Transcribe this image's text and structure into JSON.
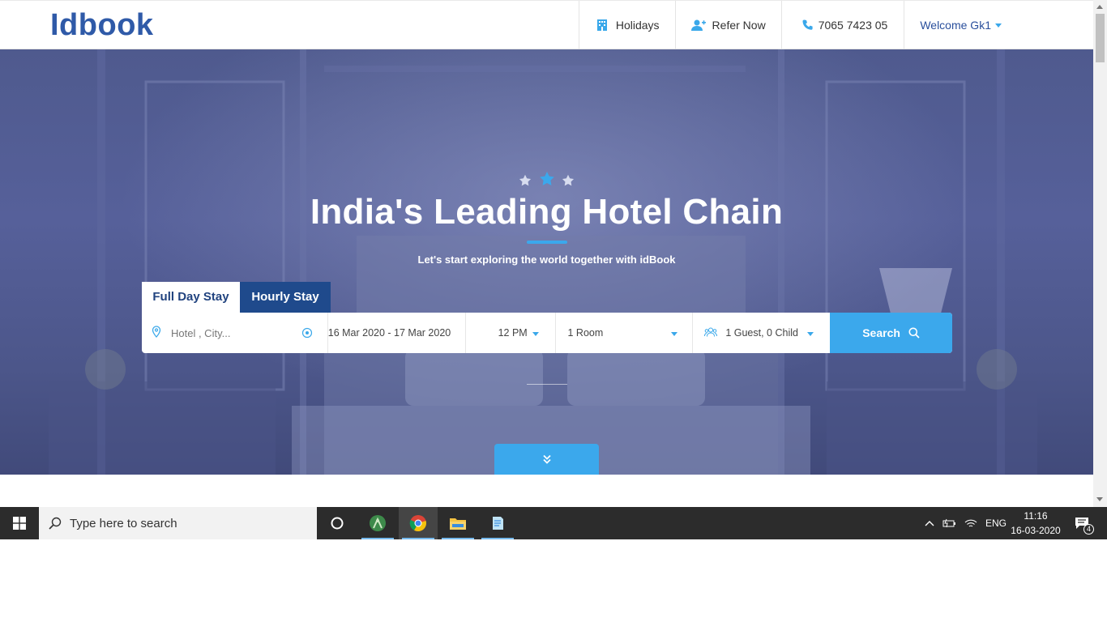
{
  "brand": {
    "logo": "Idbook",
    "logo_color": "#2f5aa8"
  },
  "nav": {
    "holidays": "Holidays",
    "refer": "Refer Now",
    "phone": "7065 7423 05",
    "welcome": "Welcome Gk1"
  },
  "hero": {
    "headline": "India's Leading Hotel Chain",
    "subline": "Let's start exploring the world together with idBook",
    "accent_color": "#3ba8ec"
  },
  "tabs": {
    "full_day": "Full Day Stay",
    "hourly": "Hourly Stay"
  },
  "search": {
    "hotel_placeholder": "Hotel , City...",
    "dates": "16 Mar 2020 - 17 Mar 2020",
    "time": "12 PM",
    "rooms": "1 Room",
    "guests": "1 Guest, 0 Child",
    "button": "Search"
  },
  "taskbar": {
    "search_placeholder": "Type here to search",
    "language": "ENG",
    "time": "11:16",
    "date": "16-03-2020",
    "notification_count": "4",
    "apps": [
      "cortana-icon",
      "android-studio-icon",
      "chrome-icon",
      "file-explorer-icon",
      "notepad-icon"
    ]
  }
}
